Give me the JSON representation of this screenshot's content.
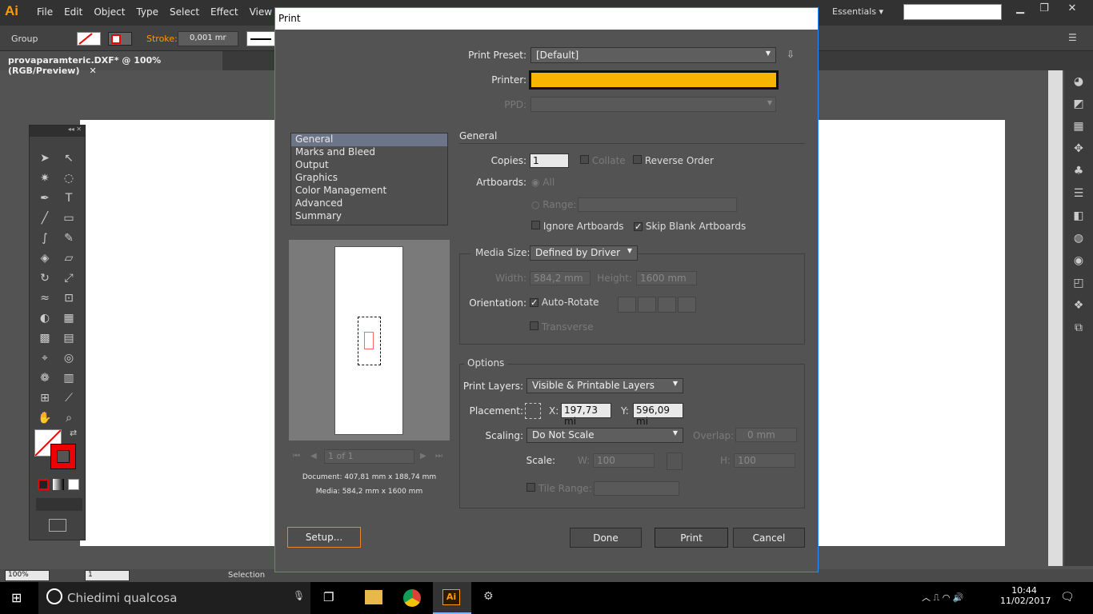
{
  "app": {
    "logo": "Ai",
    "menus": [
      "File",
      "Edit",
      "Object",
      "Type",
      "Select",
      "Effect",
      "View"
    ],
    "workspace": "Essentials",
    "document_tab": "provaparamteric.DXF* @ 100% (RGB/Preview)",
    "control_bar": {
      "group_label": "Group",
      "stroke_label": "Stroke:",
      "stroke_value": "0,001 mr"
    },
    "status": {
      "zoom": "100%",
      "page": "1",
      "mode": "Selection"
    }
  },
  "dialog": {
    "title": "Print",
    "preset_label": "Print Preset:",
    "preset_value": "[Default]",
    "printer_label": "Printer:",
    "ppd_label": "PPD:",
    "sections": [
      "General",
      "Marks and Bleed",
      "Output",
      "Graphics",
      "Color Management",
      "Advanced",
      "Summary"
    ],
    "section_heading": "General",
    "copies_label": "Copies:",
    "copies_value": "1",
    "collate_label": "Collate",
    "reverse_label": "Reverse Order",
    "artboards_label": "Artboards:",
    "all_label": "All",
    "range_label": "Range:",
    "ignore_artboards_label": "Ignore Artboards",
    "skip_blank_label": "Skip Blank Artboards",
    "media_size_label": "Media Size:",
    "media_size_value": "Defined by Driver",
    "width_label": "Width:",
    "width_value": "584,2 mm",
    "height_label": "Height:",
    "height_value": "1600 mm",
    "orientation_label": "Orientation:",
    "auto_rotate_label": "Auto-Rotate",
    "transverse_label": "Transverse",
    "options_heading": "Options",
    "print_layers_label": "Print Layers:",
    "print_layers_value": "Visible & Printable Layers",
    "placement_label": "Placement:",
    "x_label": "X:",
    "x_value": "197,73 mi",
    "y_label": "Y:",
    "y_value": "596,09 mi",
    "scaling_label": "Scaling:",
    "scaling_value": "Do Not Scale",
    "overlap_label": "Overlap:",
    "overlap_value": "0 mm",
    "scale_label": "Scale:",
    "w_label": "W:",
    "w_value": "100",
    "h_label": "H:",
    "h_value": "100",
    "tile_range_label": "Tile Range:",
    "page_nav": "1 of 1",
    "document_info": "Document: 407,81 mm x 188,74 mm",
    "media_info": "Media: 584,2 mm x 1600 mm",
    "setup_button": "Setup...",
    "done_button": "Done",
    "print_button": "Print",
    "cancel_button": "Cancel",
    "printer_color": "#f7b500"
  },
  "taskbar": {
    "search_placeholder": "Chiedimi qualcosa",
    "time": "10:44",
    "date": "11/02/2017"
  }
}
